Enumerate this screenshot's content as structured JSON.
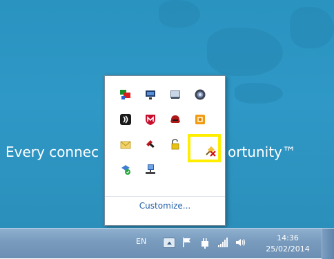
{
  "wallpaper": {
    "tagline_left": "Every connec",
    "tagline_right": "ortunity™"
  },
  "tray_overflow": {
    "icons": [
      [
        "network-connections-icon",
        "monitor-icon",
        "display-window-icon",
        "camera-lens-icon"
      ],
      [
        "wireless-signal-icon",
        "mcafee-shield-icon",
        "red-hat-icon",
        "orange-square-icon"
      ],
      [
        "envelope-icon",
        "red-stamp-icon",
        "padlock-icon",
        "pin-x-icon"
      ],
      [
        "sync-refresh-icon",
        "computer-network-icon"
      ]
    ],
    "highlighted": "pin-x-icon",
    "customize_label": "Customize..."
  },
  "taskbar": {
    "language": "EN",
    "tray_icons": [
      "show-hidden-icons-button",
      "flag-icon",
      "power-plug-icon",
      "signal-bars-icon",
      "speaker-icon"
    ],
    "time": "14:36",
    "date": "25/02/2014"
  },
  "colors": {
    "desktop": "#2f98c6",
    "taskbar": "#7a9cbe",
    "highlight": "#ffee00",
    "link": "#1e5ea8"
  }
}
